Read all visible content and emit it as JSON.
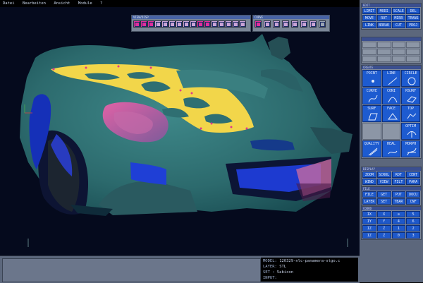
{
  "menubar": [
    "Datei",
    "Bearbeiten",
    "Ansicht",
    "Module",
    "?"
  ],
  "view_toolbar": {
    "title": "VIEW/DISP",
    "buttons": [
      "view-top",
      "view-front",
      "view-side",
      "view-iso",
      "rotate",
      "zoom-in",
      "zoom-window",
      "pan",
      "fit",
      "shade",
      "wire",
      "render",
      "refresh",
      "undo",
      "redo",
      "mesh"
    ]
  },
  "curve_toolbar": {
    "title": "CURVE",
    "buttons": [
      "curve-1",
      "curve-2",
      "curve-3",
      "curve-4",
      "curve-5",
      "curve-6",
      "curve-7",
      "curve-8"
    ]
  },
  "sidebar": {
    "edit": {
      "title": "EDIT",
      "buttons": [
        "LIMIT",
        "MODI",
        "SCALE",
        "DEL",
        "MOVE",
        "ROT",
        "MIRR",
        "TRANS",
        "LINK",
        "BREAK",
        "CUT",
        "PROJ"
      ]
    },
    "create": {
      "title": "CREATE",
      "tools": [
        {
          "label": "POINT",
          "icon": "point-icon"
        },
        {
          "label": "LINE",
          "icon": "line-icon"
        },
        {
          "label": "CIRCLE",
          "icon": "circle-icon"
        },
        {
          "label": "CURVE",
          "icon": "curve-icon"
        },
        {
          "label": "CONI",
          "icon": "conic-icon"
        },
        {
          "label": "RSURF",
          "icon": "rsurf-icon"
        },
        {
          "label": "SURF",
          "icon": "surf-icon"
        },
        {
          "label": "FACE",
          "icon": "face-icon"
        },
        {
          "label": "TOP",
          "icon": "top-icon"
        },
        {
          "label": "",
          "icon": ""
        },
        {
          "label": "",
          "icon": ""
        },
        {
          "label": "OPTIM",
          "icon": "optim-icon"
        },
        {
          "label": "QUALITY",
          "icon": "quality-icon"
        },
        {
          "label": "HEAL",
          "icon": "heal-icon"
        },
        {
          "label": "MORPH",
          "icon": "morph-icon"
        }
      ]
    },
    "display": {
      "title": "DISPLAY",
      "buttons": [
        "ZOOM",
        "SCROL",
        "ROT",
        "CENT",
        "WIND",
        "VIEW",
        "FILT",
        "PARA"
      ]
    },
    "file": {
      "title": "FILE",
      "buttons": [
        "FILE",
        "GET",
        "PUT",
        "DOCU",
        "LAYER",
        "SET",
        "TBAR",
        "CNF"
      ]
    },
    "coords": {
      "title": "COORD",
      "buttons": [
        "IX",
        "X",
        "⊙",
        "5",
        "IY",
        "Y",
        "4",
        "6",
        "IZ",
        "Z",
        "1",
        "2",
        "IZ",
        "Z",
        "0",
        "3"
      ]
    }
  },
  "status": {
    "model_label": "MODEL:",
    "model_value": "120329-nlc-panamera-stgo.c",
    "layer_label": "LAYER:",
    "layer_value": "STL",
    "set_label": "SET  :",
    "set_value": "5abicon",
    "input_label": "INPUT:",
    "input_value": ""
  },
  "colors": {
    "car_body": "#2f6f72",
    "car_blue": "#1740d6",
    "stripe_yellow": "#f2d64a",
    "viewport_bg": "#050a1d",
    "panel": "#5c677c",
    "button_blue": "#1e58c9"
  }
}
